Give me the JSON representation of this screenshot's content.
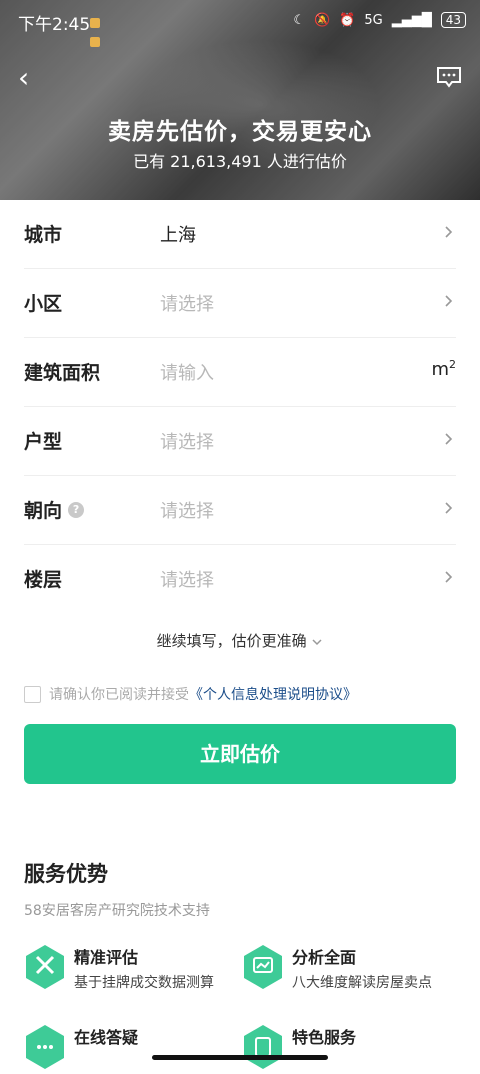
{
  "status_bar": {
    "time": "下午2:45",
    "battery": "43",
    "network": "5G"
  },
  "hero": {
    "title": "卖房先估价，交易更安心",
    "subtitle": "已有 21,613,491 人进行估价"
  },
  "form": {
    "rows": [
      {
        "label": "城市",
        "value": "上海",
        "placeholder": ""
      },
      {
        "label": "小区",
        "value": "",
        "placeholder": "请选择"
      },
      {
        "label": "建筑面积",
        "value": "",
        "placeholder": "请输入",
        "unit": "m",
        "unit_sup": "2"
      },
      {
        "label": "户型",
        "value": "",
        "placeholder": "请选择"
      },
      {
        "label": "朝向",
        "value": "",
        "placeholder": "请选择",
        "help": "?"
      },
      {
        "label": "楼层",
        "value": "",
        "placeholder": "请选择"
      }
    ]
  },
  "more_link": "继续填写，估价更准确",
  "agreement": {
    "text": "请确认你已阅读并接受",
    "link": "《个人信息处理说明协议》"
  },
  "estimate_button": "立即估价",
  "services": {
    "title": "服务优势",
    "subtitle": "58安居客房产研究院技术支持",
    "features": [
      {
        "title": "精准评估",
        "desc": "基于挂牌成交数据测算",
        "icon": "precision-icon"
      },
      {
        "title": "分析全面",
        "desc": "八大维度解读房屋卖点",
        "icon": "analysis-icon"
      },
      {
        "title": "在线答疑",
        "desc": "",
        "icon": "chat-icon"
      },
      {
        "title": "特色服务",
        "desc": "",
        "icon": "service-icon"
      }
    ]
  },
  "colors": {
    "accent": "#22c58d",
    "link": "#1c4e8a"
  }
}
